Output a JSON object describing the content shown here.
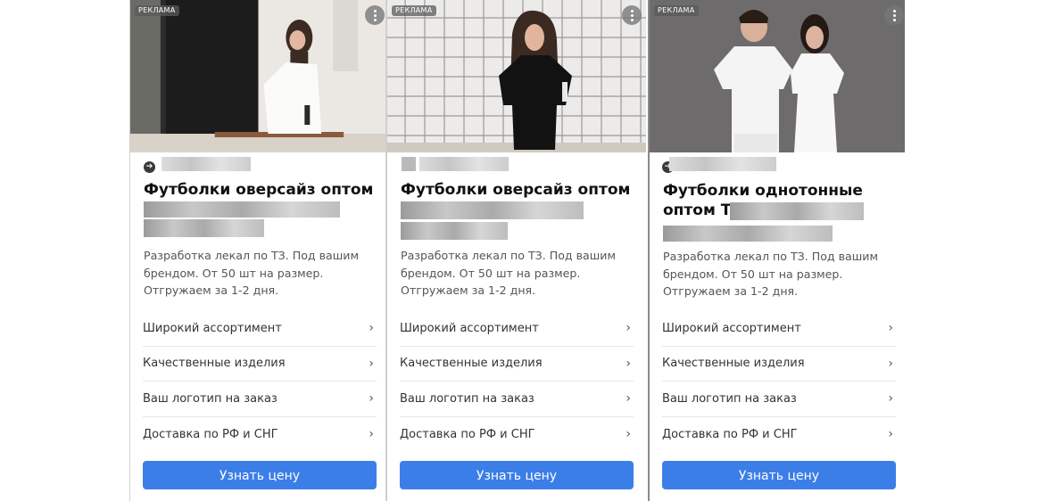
{
  "ads": [
    {
      "badge": "РЕКЛАМА",
      "title": "Футболки оверсайз оптом",
      "description": "Разработка лекал по ТЗ. Под вашим брендом. От 50 шт на размер. Отгружаем за 1-2 дня.",
      "sitelinks": [
        "Широкий ассортимент",
        "Качественные изделия",
        "Ваш логотип на заказ",
        "Доставка по РФ и СНГ"
      ],
      "cta": "Узнать цену",
      "domain_icon": "arrow-right-circle-icon",
      "photo": "woman-white-oversize-tshirt"
    },
    {
      "badge": "РЕКЛАМА",
      "title": "Футболки оверсайз оптом",
      "description": "Разработка лекал по ТЗ. Под вашим брендом. От 50 шт на размер. Отгружаем за 1-2 дня.",
      "sitelinks": [
        "Широкий ассортимент",
        "Качественные изделия",
        "Ваш логотип на заказ",
        "Доставка по РФ и СНГ"
      ],
      "cta": "Узнать цену",
      "domain_icon": "favicon-placeholder",
      "photo": "woman-black-oversize-tshirt"
    },
    {
      "badge": "РЕКЛАМА",
      "title": "Футболки однотонные оптом Т",
      "description": "Разработка лекал по ТЗ. Под вашим брендом. От 50 шт на размер. Отгружаем за 1-2 дня.",
      "sitelinks": [
        "Широкий ассортимент",
        "Качественные изделия",
        "Ваш логотип на заказ",
        "Доставка по РФ и СНГ"
      ],
      "cta": "Узнать цену",
      "domain_icon": "arrow-right-circle-icon",
      "photo": "man-and-woman-white-tshirts"
    }
  ],
  "colors": {
    "cta_background": "#3c7ee8",
    "title_text": "#111111",
    "body_text": "#555555"
  }
}
